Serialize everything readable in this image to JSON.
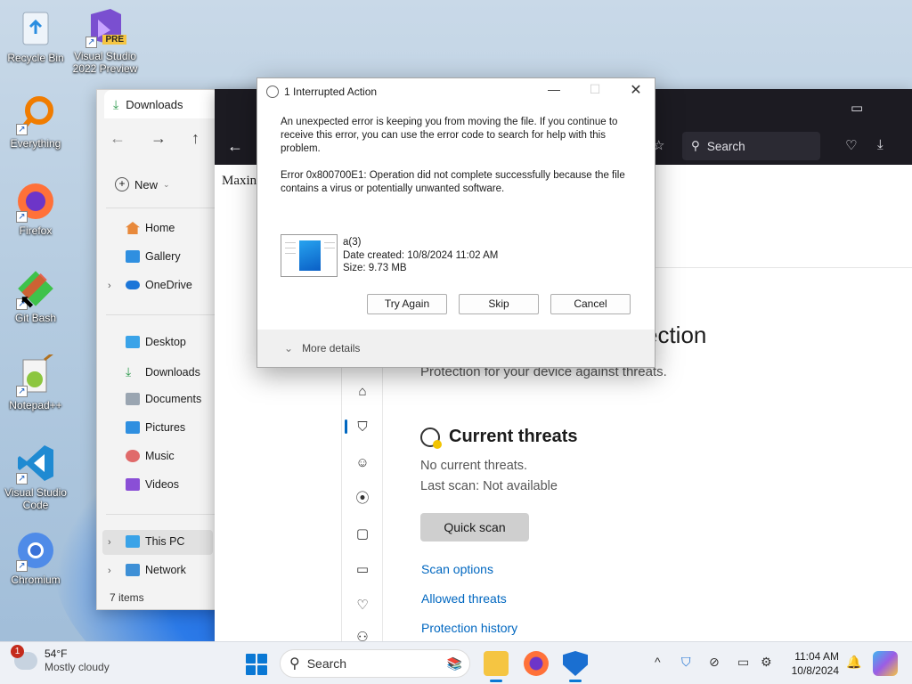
{
  "desktop": {
    "icons": [
      {
        "label": "Recycle Bin"
      },
      {
        "label": "Visual Studio 2022 Preview",
        "badge": "PRE"
      },
      {
        "label": "Everything"
      },
      {
        "label": "Firefox"
      },
      {
        "label": "Git Bash"
      },
      {
        "label": "Notepad++"
      },
      {
        "label": "Visual Studio Code"
      },
      {
        "label": "Chromium"
      }
    ]
  },
  "explorer": {
    "tab_label": "Downloads",
    "new_label": "New",
    "nav": [
      {
        "label": "Home"
      },
      {
        "label": "Gallery"
      },
      {
        "label": "OneDrive"
      },
      {
        "label": "Desktop"
      },
      {
        "label": "Downloads"
      },
      {
        "label": "Documents"
      },
      {
        "label": "Pictures"
      },
      {
        "label": "Music"
      },
      {
        "label": "Videos"
      },
      {
        "label": "This PC"
      },
      {
        "label": "Network"
      }
    ],
    "status": "7 items"
  },
  "browser": {
    "search_placeholder": "Search",
    "page_partial_text": "Maxin"
  },
  "defender": {
    "title_partial": "ection",
    "subtitle": "Protection for your device against threats.",
    "section_heading": "Current threats",
    "no_threats": "No current threats.",
    "last_scan": "Last scan: Not available",
    "quick_scan": "Quick scan",
    "links": [
      "Scan options",
      "Allowed threats",
      "Protection history"
    ]
  },
  "dialog": {
    "title": "1 Interrupted Action",
    "message": "An unexpected error is keeping you from moving the file. If you continue to receive this error, you can use the error code to search for help with this problem.",
    "error": "Error 0x800700E1: Operation did not complete successfully because the file contains a virus or potentially unwanted software.",
    "file_name": "a(3)",
    "file_date": "Date created: 10/8/2024 11:02 AM",
    "file_size": "Size: 9.73 MB",
    "buttons": {
      "try_again": "Try Again",
      "skip": "Skip",
      "cancel": "Cancel"
    },
    "more_details": "More details"
  },
  "taskbar": {
    "weather_temp": "54°F",
    "weather_desc": "Mostly cloudy",
    "weather_badge": "1",
    "search_label": "Search",
    "time": "11:04 AM",
    "date": "10/8/2024"
  },
  "colors": {
    "accent": "#0a78d4",
    "link": "#0067c0",
    "browser_toolbar": "#1c1b22"
  }
}
